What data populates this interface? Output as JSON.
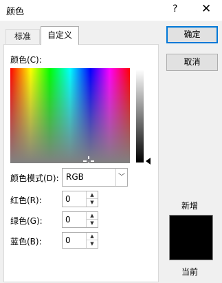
{
  "window": {
    "title": "颜色",
    "help": "?",
    "close": "✕"
  },
  "tabs": [
    {
      "label": "标准"
    },
    {
      "label": "自定义"
    }
  ],
  "custom": {
    "colors_label": "颜色(C):",
    "mode_label": "颜色模式(D):",
    "mode_value": "RGB",
    "red_label": "红色(R):",
    "red_value": "0",
    "green_label": "绿色(G):",
    "green_value": "0",
    "blue_label": "蓝色(B):",
    "blue_value": "0"
  },
  "buttons": {
    "ok": "确定",
    "cancel": "取消"
  },
  "preview": {
    "new_label": "新增",
    "current_label": "当前",
    "color": "#000000"
  },
  "icons": {
    "spin_up": "▲",
    "spin_down": "▼",
    "dropdown": "﹀"
  }
}
